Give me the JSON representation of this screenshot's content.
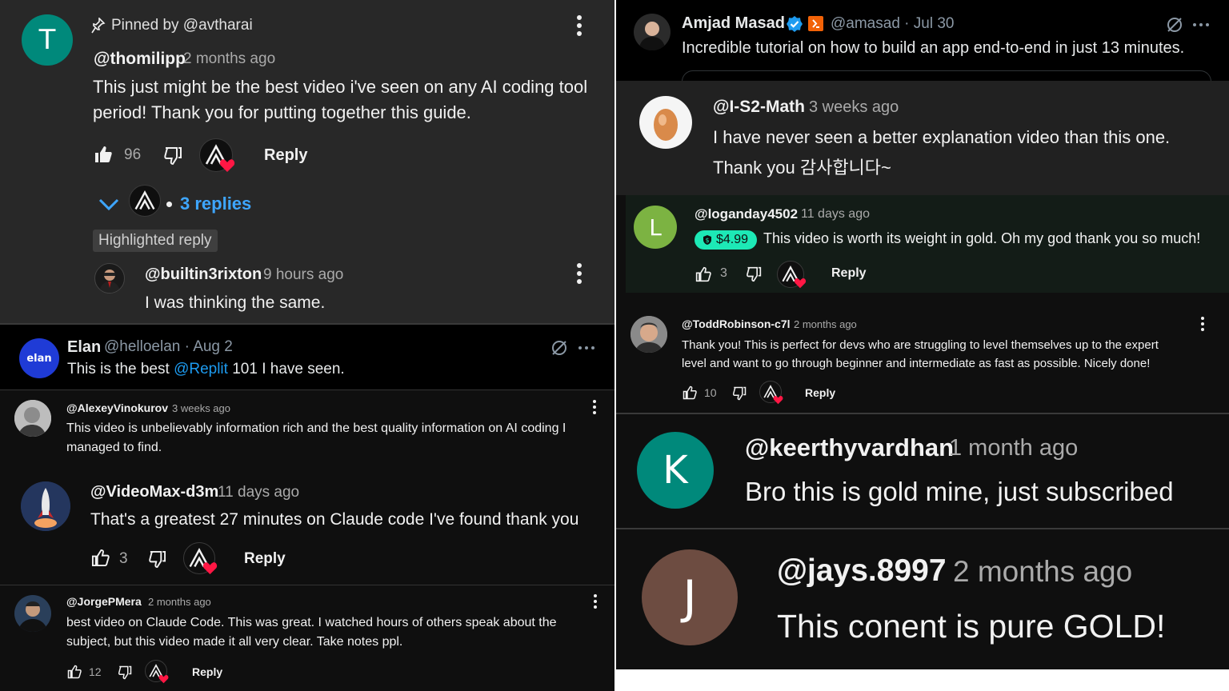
{
  "colors": {
    "dark_bg": "#282828",
    "black_bg": "#0f0f0f",
    "accent_blue": "#3ea6ff",
    "heart": "#ff1744",
    "superchat_green": "#1de9b6"
  },
  "p1": {
    "avatar_letter": "T",
    "pinned_label": "Pinned by @avtharai",
    "handle": "@thomilipp",
    "ago": "2 months ago",
    "text_line1": "This just might be the best video i've seen on any AI coding tool",
    "text_line2": "period! Thank you for putting together this guide.",
    "likes": "96",
    "reply": "Reply",
    "replies_label": "3 replies",
    "highlighted_label": "Highlighted reply",
    "reply_handle": "@builtin3rixton",
    "reply_ago": "9 hours ago",
    "reply_text": "I was thinking the same."
  },
  "p2": {
    "name": "Amjad Masad",
    "handle_date": "@amasad · Jul 30",
    "text": "Incredible tutorial on how to build an app end-to-end in just 13 minutes."
  },
  "p3": {
    "handle": "@I-S2-Math",
    "ago": "3 weeks ago",
    "text_line1": "I have never seen a better explanation video than this one.",
    "text_line2": "Thank you 감사합니다~"
  },
  "p4": {
    "avatar_letter": "L",
    "handle": "@loganday4502",
    "ago": "11 days ago",
    "amount": "$4.99",
    "text": "This video is worth its weight in gold. Oh my god thank you so much!",
    "likes": "3",
    "reply": "Reply"
  },
  "p5": {
    "avatar_text": "elan",
    "name": "Elan",
    "handle_date": "@helloelan · Aug 2",
    "text_before": "This is the best ",
    "mention": "@Replit",
    "text_after": " 101 I have seen."
  },
  "p6": {
    "handle": "@ToddRobinson-c7l",
    "ago": "2 months ago",
    "text_line1": "Thank you!  This is perfect for devs who are struggling to level themselves up to the expert",
    "text_line2": "level and want to go through beginner and intermediate as fast as possible. Nicely done!",
    "likes": "10",
    "reply": "Reply"
  },
  "p7": {
    "handle": "@AlexeyVinokurov",
    "ago": "3 weeks ago",
    "text_line1": "This video is unbelievably information rich and the best quality information on AI coding I",
    "text_line2": "managed to find."
  },
  "p8": {
    "handle": "@VideoMax-d3m",
    "ago": "11 days ago",
    "text": "That's a greatest 27 minutes on Claude code I've found thank you",
    "likes": "3",
    "reply": "Reply"
  },
  "p9": {
    "avatar_letter": "K",
    "handle": "@keerthyvardhan",
    "ago": "1 month ago",
    "text": "Bro this is gold mine, just subscribed"
  },
  "p10": {
    "handle": "@JorgePMera",
    "ago": "2 months ago",
    "text_line1": "best video on Claude Code. This was great. I watched hours of others speak about the",
    "text_line2": "subject, but this video made it all very clear. Take notes ppl.",
    "likes": "12",
    "reply": "Reply"
  },
  "p11": {
    "avatar_letter": "J",
    "handle": "@jays.8997",
    "ago": "2 months ago",
    "text": "This conent is pure GOLD!"
  }
}
